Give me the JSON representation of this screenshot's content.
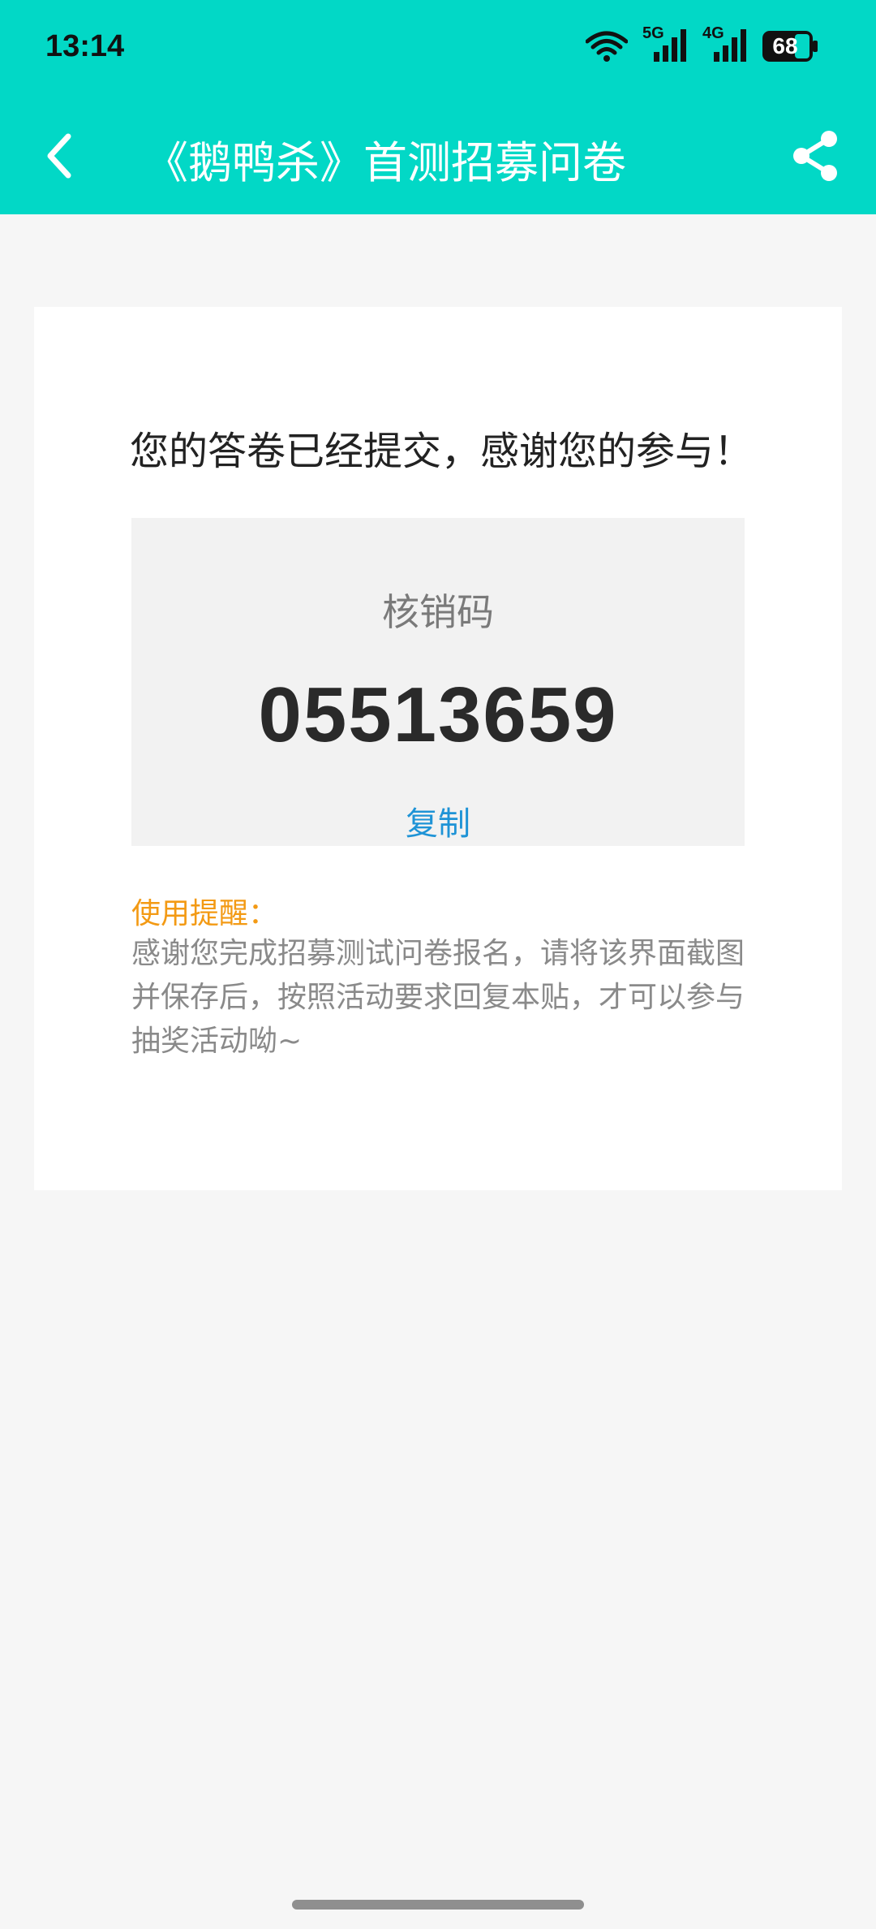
{
  "status_bar": {
    "time": "13:14",
    "network_5g": "5G",
    "network_4g": "4G",
    "battery": "68"
  },
  "nav": {
    "title": "《鹅鸭杀》首测招募问卷"
  },
  "card": {
    "thanks": "您的答卷已经提交，感谢您的参与！",
    "code_label": "核销码",
    "code_value": "05513659",
    "copy_label": "复制",
    "tip_title": "使用提醒：",
    "tip_body": "感谢您完成招募测试问卷报名，请将该界面截图并保存后，按照活动要求回复本贴，才可以参与抽奖活动呦~"
  },
  "colors": {
    "header": "#02d8c6",
    "copy_link": "#1e93d6",
    "tip_title": "#f39a14"
  }
}
